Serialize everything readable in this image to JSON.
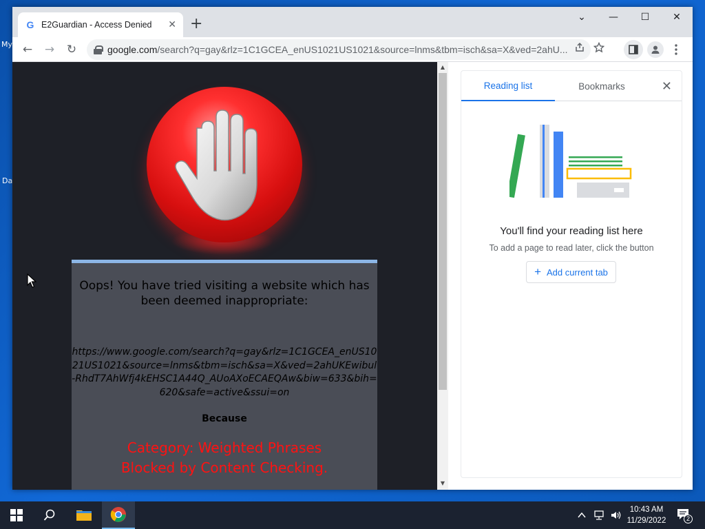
{
  "desktop": {
    "fragments": [
      "My",
      "Da"
    ]
  },
  "tab": {
    "favicon": "G",
    "title": "E2Guardian - Access Denied",
    "close": "✕"
  },
  "newtab": "+",
  "window_controls": {
    "collapse": "⌄",
    "minimize": "—",
    "maximize": "☐",
    "close": "✕"
  },
  "toolbar": {
    "back": "←",
    "forward": "→",
    "reload": "↻"
  },
  "omnibox": {
    "host": "google.com",
    "path": "/search?q=gay&rlz=1C1GCEA_enUS1021US1021&source=lnms&tbm=isch&sa=X&ved=2ahU..."
  },
  "page": {
    "headline": "Oops! You have tried visiting a website which has been deemed inappropriate:",
    "blocked_url": "https://www.google.com/search?q=gay&rlz=1C1GCEA_enUS1021US1021&source=lnms&tbm=isch&sa=X&ved=2ahUKEwibul-RhdT7AhWfj4kEHSC1A44Q_AUoAXoECAEQAw&biw=633&bih=620&safe=active&ssui=on",
    "because": "Because",
    "reason_line1": "Category: Weighted Phrases",
    "reason_line2": "Blocked by Content Checking."
  },
  "side_panel": {
    "tabs": [
      "Reading list",
      "Bookmarks"
    ],
    "active_tab": "Reading list",
    "empty_title": "You'll find your reading list here",
    "empty_subtitle": "To add a page to read later, click the button",
    "add_button": "Add current tab",
    "colors": {
      "accent": "#1a73e8",
      "green": "#34a853",
      "blue": "#4285f4",
      "yellow": "#fbbc04"
    }
  },
  "taskbar": {
    "time": "10:43 AM",
    "date": "11/29/2022",
    "notification_count": "2"
  }
}
